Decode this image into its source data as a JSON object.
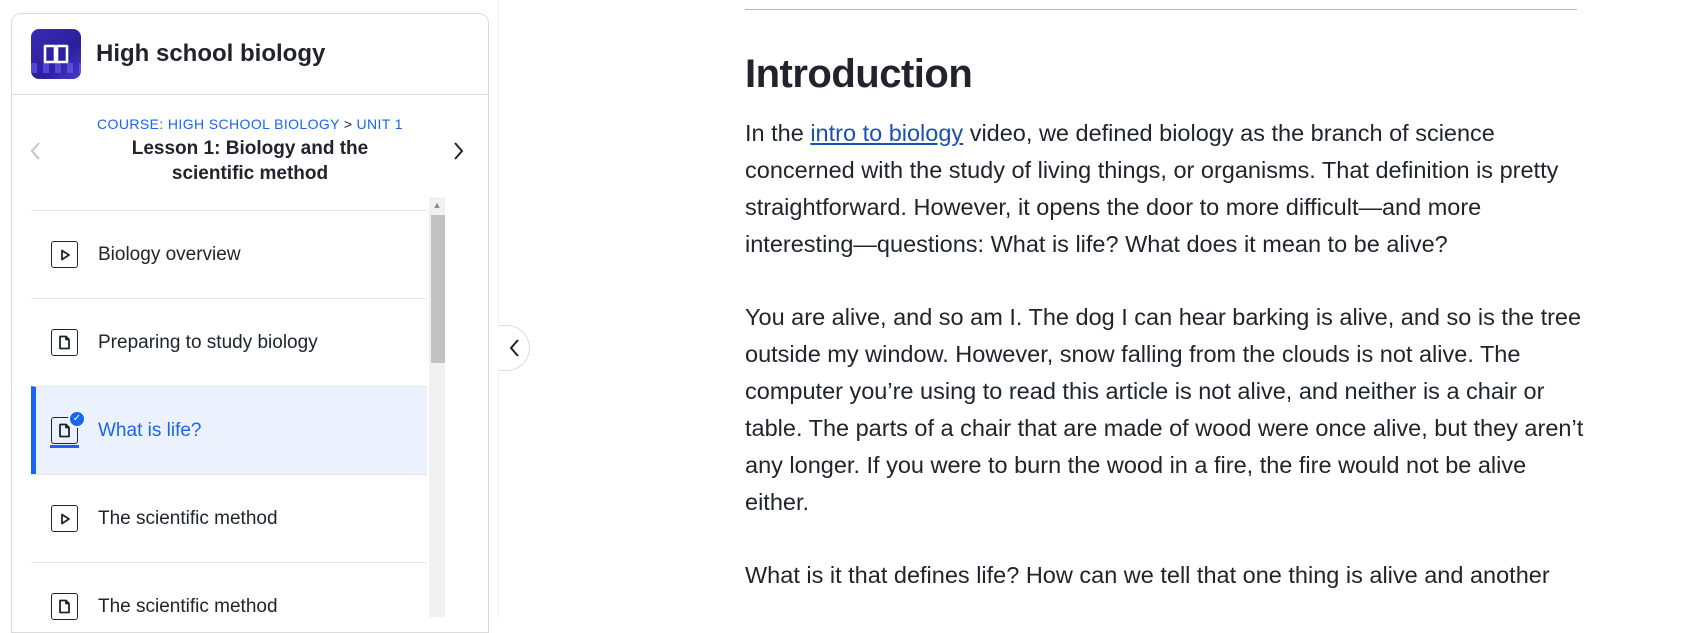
{
  "sidebar": {
    "course_title": "High school biology",
    "breadcrumb": {
      "course": "COURSE: HIGH SCHOOL BIOLOGY",
      "separator": ">",
      "unit": "UNIT 1"
    },
    "lesson_title": "Lesson 1: Biology and the scientific method",
    "items": [
      {
        "label": "Biology overview",
        "icon": "video-icon"
      },
      {
        "label": "Preparing to study biology",
        "icon": "article-icon"
      },
      {
        "label": "What is life?",
        "icon": "article-icon",
        "active": true,
        "completed": true
      },
      {
        "label": "The scientific method",
        "icon": "video-icon"
      },
      {
        "label": "The scientific method",
        "icon": "article-icon"
      }
    ]
  },
  "article": {
    "heading": "Introduction",
    "p1_before_link": "In the ",
    "p1_link": "intro to biology",
    "p1_after_link": " video, we defined biology as the branch of science concerned with the study of living things, or organisms. That definition is pretty straightforward. However, it opens the door to more difficult—and more interesting—questions: What is life? What does it mean to be alive?",
    "p2": "You are alive, and so am I. The dog I can hear barking is alive, and so is the tree outside my window. However, snow falling from the clouds is not alive. The computer you’re using to read this article is not alive, and neither is a chair or table. The parts of a chair that are made of wood were once alive, but they aren’t any longer. If you were to burn the wood in a fire, the fire would not be alive either.",
    "p3": "What is it that defines life? How can we tell that one thing is alive and another"
  },
  "colors": {
    "accent": "#1865f2",
    "link": "#1b50b3",
    "active_bg": "#ebf2fe"
  }
}
